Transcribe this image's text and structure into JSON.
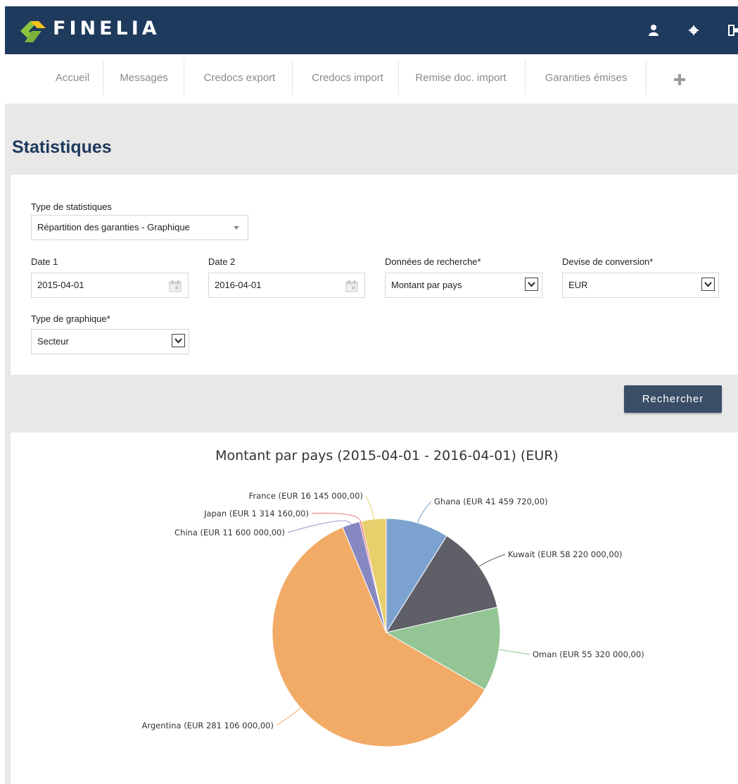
{
  "app": {
    "brand": "FINELIA"
  },
  "header_icons": [
    "user-icon",
    "gear-icon",
    "logout-icon"
  ],
  "nav": {
    "items": [
      {
        "label": "Accueil"
      },
      {
        "label": "Messages"
      },
      {
        "label": "Credocs export"
      },
      {
        "label": "Credocs import"
      },
      {
        "label": "Remise doc. import"
      },
      {
        "label": "Garanties émises"
      }
    ],
    "more_icon": "plus-icon"
  },
  "page": {
    "title": "Statistiques"
  },
  "form": {
    "stat_type": {
      "label": "Type de statistiques",
      "value": "Répartition des garanties - Graphique"
    },
    "date1": {
      "label": "Date 1",
      "value": "2015-04-01"
    },
    "date2": {
      "label": "Date 2",
      "value": "2016-04-01"
    },
    "search_data": {
      "label": "Données de recherche*",
      "value": "Montant par pays"
    },
    "currency": {
      "label": "Devise de conversion*",
      "value": "EUR"
    },
    "chart_type": {
      "label": "Type de graphique*",
      "value": "Secteur"
    }
  },
  "actions": {
    "search_label": "Rechercher"
  },
  "colors": {
    "brand_dark": "#1e3a5c",
    "button": "#3a4e68"
  },
  "chart_data": {
    "type": "pie",
    "title": "Montant par pays (2015-04-01 - 2016-04-01) (EUR)",
    "slices": [
      {
        "name": "Ghana",
        "value": 41459720,
        "label": "Ghana (EUR 41 459 720,00)",
        "color": "#7ca3d0"
      },
      {
        "name": "Kuwait",
        "value": 58220000,
        "label": "Kuwait (EUR 58 220 000,00)",
        "color": "#5f5f68"
      },
      {
        "name": "Oman",
        "value": 55320000,
        "label": "Oman (EUR 55 320 000,00)",
        "color": "#93c595"
      },
      {
        "name": "Argentina",
        "value": 281106000,
        "label": "Argentina (EUR 281 106 000,00)",
        "color": "#f1ab67"
      },
      {
        "name": "China",
        "value": 11600000,
        "label": "China (EUR 11 600 000,00)",
        "color": "#8787c2"
      },
      {
        "name": "Japan",
        "value": 1314160,
        "label": "Japan (EUR 1 314 160,00)",
        "color": "#ee6f6f"
      },
      {
        "name": "France",
        "value": 16145000,
        "label": "France (EUR 16 145 000,00)",
        "color": "#e7cf6c"
      }
    ]
  }
}
